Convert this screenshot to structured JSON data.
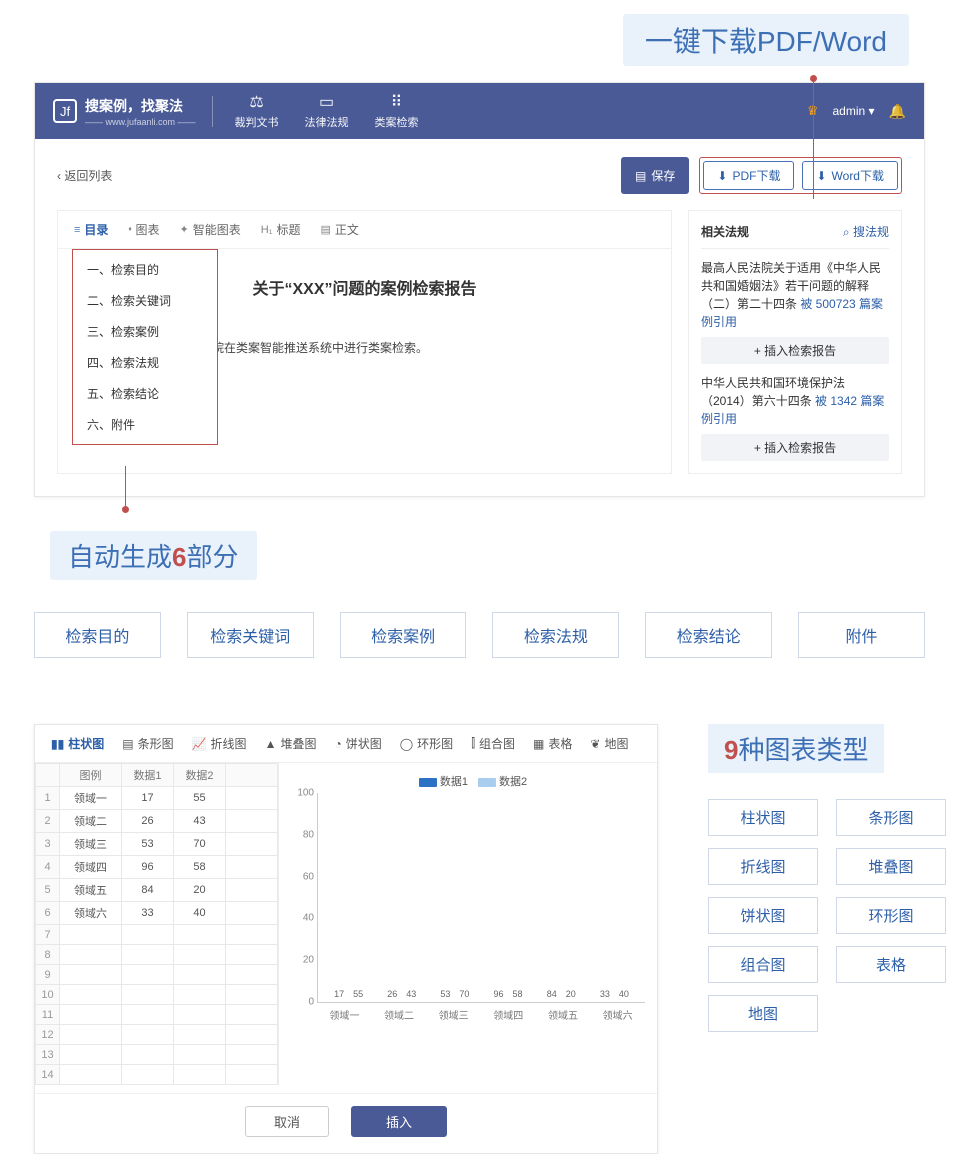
{
  "callouts": {
    "download": "一键下载PDF/Word",
    "six_parts_pre": "自动生成",
    "six_parts_num": "6",
    "six_parts_post": "部分",
    "nine_types_num": "9",
    "nine_types_post": "种图表类型"
  },
  "header": {
    "logo_glyph": "Jf",
    "logo_text": "搜案例，找聚法",
    "logo_sub": "—— www.jufaanli.com ——",
    "nav": [
      "裁判文书",
      "法律法规",
      "类案检索"
    ],
    "user": "admin",
    "caret": "▾"
  },
  "toolbar": {
    "back": "返回列表",
    "save": "保存",
    "pdf": "PDF下载",
    "word": "Word下载",
    "dl_icon": "⬇"
  },
  "doc_tabs": {
    "outline": "目录",
    "chart": "图表",
    "smart": "智能图表",
    "heading": "标题",
    "body": "正文",
    "outline_ic": "≡",
    "chart_ic": "⬪",
    "smart_ic": "✦",
    "heading_ic": "H₁",
    "body_ic": "▤"
  },
  "outline_items": [
    "一、检索目的",
    "二、检索关键词",
    "三、检索案例",
    "四、检索法规",
    "五、检索结论",
    "六、附件"
  ],
  "report": {
    "title": "关于“XXX”问题的案例检索报告",
    "line": "焦点）问题，本院在类案智能推送系统中进行类案检索。",
    "echo": "二、检索关键词"
  },
  "side": {
    "title": "相关法规",
    "search": "搜法规",
    "search_ic": "⌕",
    "insert": "+ 插入检索报告",
    "items": [
      {
        "text_a": "最高人民法院关于适用《中华人民共和国婚姻法》若干问题的解释（二）第二十四条 ",
        "cite": "被 500723 篇案例引用"
      },
      {
        "text_a": "中华人民共和国环境保护法（2014）第六十四条 ",
        "cite": "被 1342 篇案例引用"
      }
    ]
  },
  "parts": [
    "检索目的",
    "检索关键词",
    "检索案例",
    "检索法规",
    "检索结论",
    "附件"
  ],
  "chart_tabs": [
    {
      "label": "柱状图",
      "ic": "▮▮"
    },
    {
      "label": "条形图",
      "ic": "▤"
    },
    {
      "label": "折线图",
      "ic": "📈"
    },
    {
      "label": "堆叠图",
      "ic": "▲"
    },
    {
      "label": "饼状图",
      "ic": "◔"
    },
    {
      "label": "环形图",
      "ic": "◯"
    },
    {
      "label": "组合图",
      "ic": "⫿"
    },
    {
      "label": "表格",
      "ic": "▦"
    },
    {
      "label": "地图",
      "ic": "❦"
    }
  ],
  "sheet": {
    "headers": [
      "图例",
      "数据1",
      "数据2"
    ],
    "total_rows": 14
  },
  "chart_data": {
    "type": "bar",
    "categories": [
      "领域一",
      "领域二",
      "领域三",
      "领域四",
      "领域五",
      "领域六"
    ],
    "series": [
      {
        "name": "数据1",
        "values": [
          17,
          26,
          53,
          96,
          84,
          33
        ],
        "color": "#2b72c4"
      },
      {
        "name": "数据2",
        "values": [
          55,
          43,
          70,
          58,
          20,
          40
        ],
        "color": "#a8cdee"
      }
    ],
    "ylim": [
      0,
      100
    ],
    "yticks": [
      0,
      20,
      40,
      60,
      80,
      100
    ],
    "title": "",
    "xlabel": "",
    "ylabel": ""
  },
  "dialog": {
    "cancel": "取消",
    "insert": "插入"
  },
  "type_grid": [
    "柱状图",
    "条形图",
    "折线图",
    "堆叠图",
    "饼状图",
    "环形图",
    "组合图",
    "表格",
    "地图"
  ]
}
